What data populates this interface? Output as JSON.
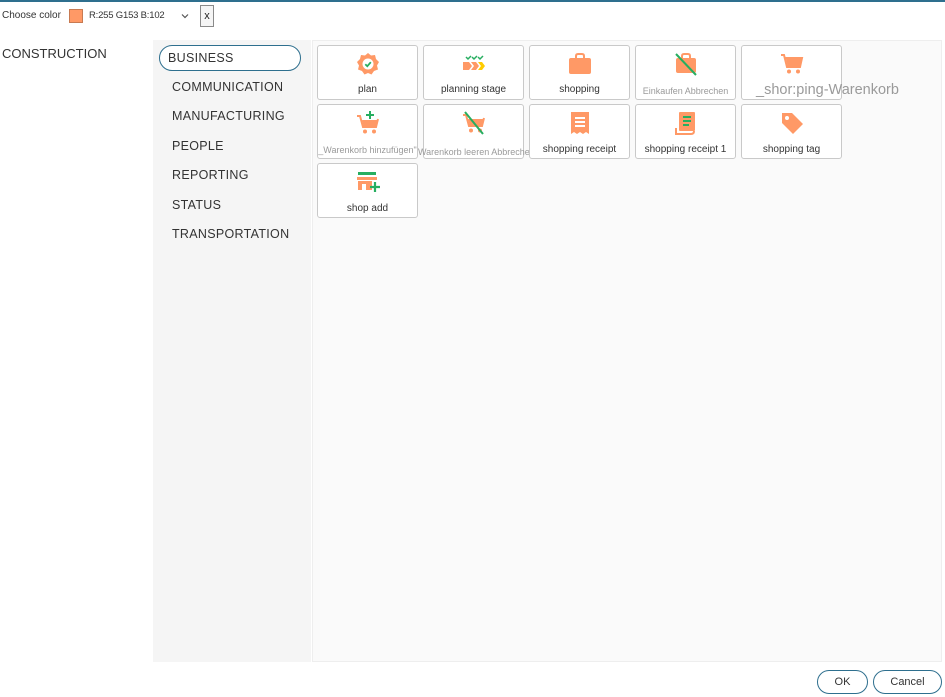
{
  "toolbar": {
    "choose_label": "Choose color",
    "swatch_color": "#ff9966",
    "rgb_label": "R:255 G153 B:102",
    "close_label": "x"
  },
  "categories": [
    {
      "label": "CONSTRUCTION"
    }
  ],
  "subcategories": [
    {
      "label": "BUSINESS",
      "selected": true
    },
    {
      "label": "COMMUNICATION"
    },
    {
      "label": "MANUFACTURING"
    },
    {
      "label": "PEOPLE"
    },
    {
      "label": "REPORTING"
    },
    {
      "label": "STATUS"
    },
    {
      "label": "TRANSPORTATION"
    }
  ],
  "icons": [
    {
      "label": "plan",
      "icon": "plan-badge-icon"
    },
    {
      "label": "planning stage",
      "icon": "planning-stage-icon"
    },
    {
      "label": "shopping",
      "icon": "shopping-bag-icon"
    },
    {
      "label": "Einkaufen Abbrechen",
      "icon": "shopping-cancel-icon"
    },
    {
      "label": "_shor:ping-Warenkorb",
      "icon": "shopping-cart-icon"
    },
    {
      "label": "_Warenkorb hinzufügen\"",
      "icon": "cart-add-icon"
    },
    {
      "label": "Warenkorb leeren Abbrechen",
      "icon": "cart-remove-icon"
    },
    {
      "label": "shopping receipt",
      "icon": "receipt-icon"
    },
    {
      "label": "shopping receipt 1",
      "icon": "receipt-alt-icon"
    },
    {
      "label": "shopping tag",
      "icon": "tag-icon"
    },
    {
      "label": "shop add",
      "icon": "shop-add-icon"
    }
  ],
  "colors": {
    "accent": "#2e6f8e",
    "icon_orange": "#ff9966",
    "icon_green": "#27ae60"
  },
  "footer": {
    "ok_label": "OK",
    "cancel_label": "Cancel"
  }
}
